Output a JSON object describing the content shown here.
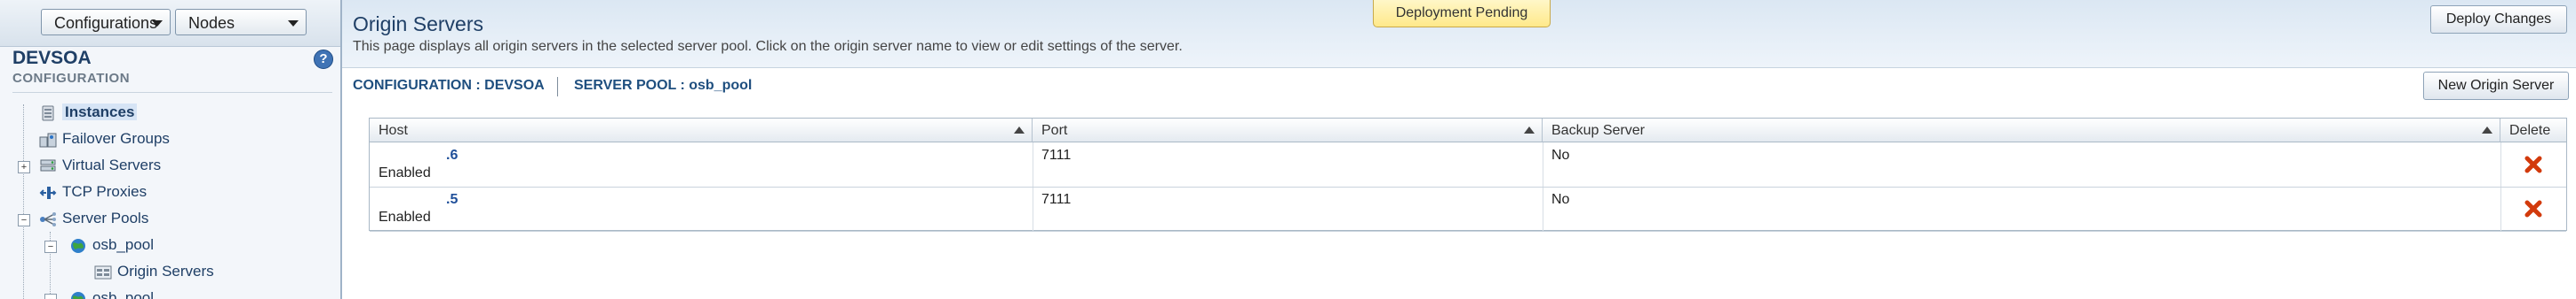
{
  "sidebar": {
    "config_combo": "Configurations",
    "nodes_combo": "Nodes",
    "title": "DEVSOA",
    "subtitle": "CONFIGURATION",
    "help": "?",
    "tree": {
      "instances": "Instances",
      "failover": "Failover Groups",
      "virtual_servers": "Virtual Servers",
      "tcp_proxies": "TCP Proxies",
      "server_pools": "Server Pools",
      "pool1": "osb_pool",
      "origin_servers": "Origin Servers",
      "pool2": "osb_pool"
    }
  },
  "header": {
    "title": "Origin Servers",
    "description": "This page displays all origin servers in the selected server pool. Click on the origin server name to view or edit settings of the server.",
    "pending": "Deployment Pending",
    "deploy": "Deploy Changes"
  },
  "subheader": {
    "configuration": "CONFIGURATION : DEVSOA",
    "server_pool": "SERVER POOL : osb_pool",
    "new_button": "New Origin Server"
  },
  "table": {
    "headers": {
      "host": "Host",
      "port": "Port",
      "backup": "Backup Server",
      "delete": "Delete"
    },
    "rows": [
      {
        "host": ".6",
        "status": "Enabled",
        "port": "7111",
        "backup": "No"
      },
      {
        "host": ".5",
        "status": "Enabled",
        "port": "7111",
        "backup": "No"
      }
    ]
  },
  "colors": {
    "accent": "#1f3f66",
    "link": "#1f4f99",
    "delete": "#d23a0c",
    "pending": "#ffe98a"
  }
}
